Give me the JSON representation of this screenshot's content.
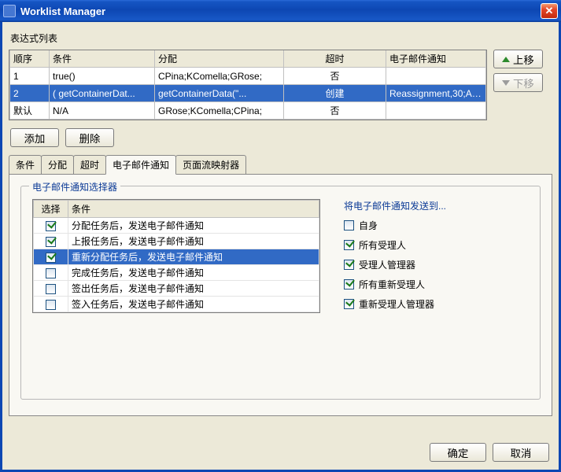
{
  "title": "Worklist Manager",
  "section_label": "表达式列表",
  "table": {
    "headers": {
      "seq": "顺序",
      "cond": "条件",
      "assign": "分配",
      "timeout": "超时",
      "email": "电子邮件通知"
    },
    "rows": [
      {
        "seq": "1",
        "cond": "true()",
        "assign": "CPina;KComella;GRose;",
        "timeout": "否",
        "email": "",
        "selected": false
      },
      {
        "seq": "2",
        "cond": "( getContainerDat...",
        "assign": "getContainerData(\"...",
        "timeout": "创建",
        "email": "Reassignment,30;As...",
        "selected": true
      },
      {
        "seq": "默认",
        "cond": "N/A",
        "assign": "GRose;KComella;CPina;",
        "timeout": "否",
        "email": "",
        "selected": false
      }
    ]
  },
  "buttons": {
    "move_up": "上移",
    "move_down": "下移",
    "add": "添加",
    "delete": "删除",
    "ok": "确定",
    "cancel": "取消"
  },
  "tabs": {
    "items": [
      {
        "id": "cond",
        "label": "条件"
      },
      {
        "id": "assign",
        "label": "分配"
      },
      {
        "id": "timeout",
        "label": "超时"
      },
      {
        "id": "email",
        "label": "电子邮件通知",
        "active": true
      },
      {
        "id": "reflect",
        "label": "页面流映射器"
      }
    ]
  },
  "selector": {
    "legend": "电子邮件通知选择器",
    "headers": {
      "select": "选择",
      "cond": "条件"
    },
    "rows": [
      {
        "checked": true,
        "label": "分配任务后，发送电子邮件通知",
        "selected": false
      },
      {
        "checked": true,
        "label": "上报任务后，发送电子邮件通知",
        "selected": false
      },
      {
        "checked": true,
        "label": "重新分配任务后，发送电子邮件通知",
        "selected": true
      },
      {
        "checked": false,
        "label": "完成任务后，发送电子邮件通知",
        "selected": false
      },
      {
        "checked": false,
        "label": "签出任务后，发送电子邮件通知",
        "selected": false
      },
      {
        "checked": false,
        "label": "签入任务后，发送电子邮件通知",
        "selected": false
      }
    ]
  },
  "send_to": {
    "title": "将电子邮件通知发送到...",
    "options": [
      {
        "checked": false,
        "label": "自身"
      },
      {
        "checked": true,
        "label": "所有受理人"
      },
      {
        "checked": true,
        "label": "受理人管理器"
      },
      {
        "checked": true,
        "label": "所有重新受理人"
      },
      {
        "checked": true,
        "label": "重新受理人管理器"
      }
    ]
  }
}
